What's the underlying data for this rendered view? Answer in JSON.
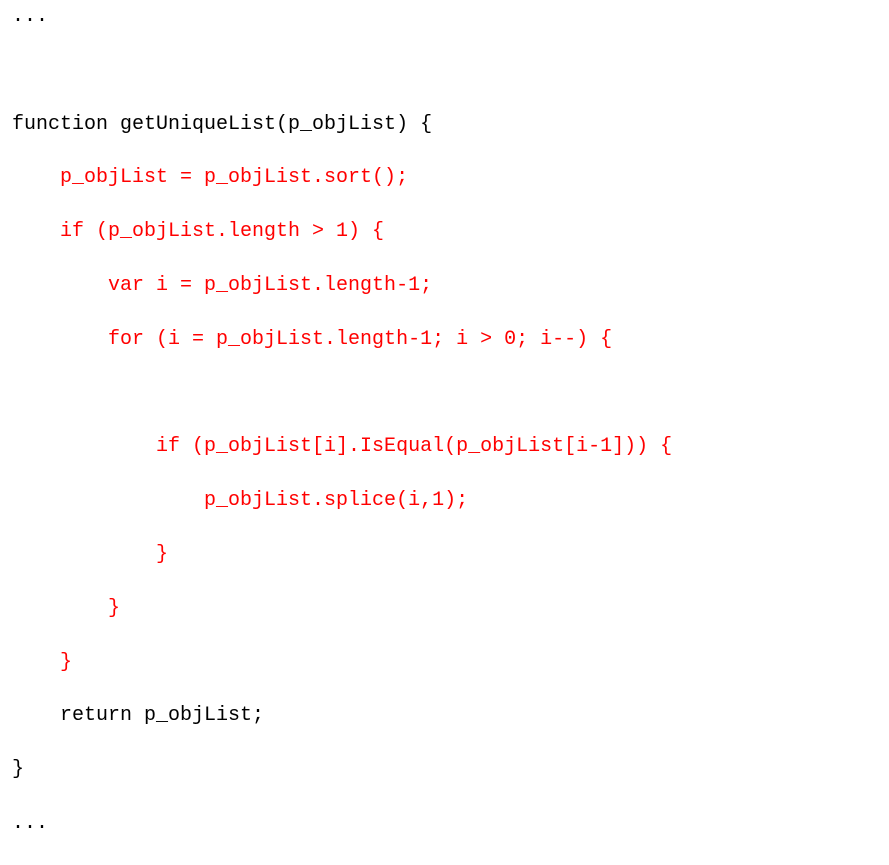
{
  "colors": {
    "default_text": "#000000",
    "highlighted_text": "#ff0000",
    "background": "#ffffff"
  },
  "code": {
    "lines": [
      {
        "text": "...",
        "color": "black"
      },
      {
        "text": "",
        "color": "black"
      },
      {
        "text": "function getUniqueList(p_objList) {",
        "color": "black"
      },
      {
        "text": "    p_objList = p_objList.sort();",
        "color": "red"
      },
      {
        "text": "    if (p_objList.length > 1) {",
        "color": "red"
      },
      {
        "text": "        var i = p_objList.length-1;",
        "color": "red"
      },
      {
        "text": "        for (i = p_objList.length-1; i > 0; i--) {",
        "color": "red"
      },
      {
        "text": "",
        "color": "red"
      },
      {
        "text": "            if (p_objList[i].IsEqual(p_objList[i-1])) {",
        "color": "red"
      },
      {
        "text": "                p_objList.splice(i,1);",
        "color": "red"
      },
      {
        "text": "            }",
        "color": "red"
      },
      {
        "text": "        }",
        "color": "red"
      },
      {
        "text": "    }",
        "color": "red"
      },
      {
        "text": "    return p_objList;",
        "color": "black"
      },
      {
        "text": "}",
        "color": "black"
      },
      {
        "text": "...",
        "color": "black"
      }
    ]
  }
}
